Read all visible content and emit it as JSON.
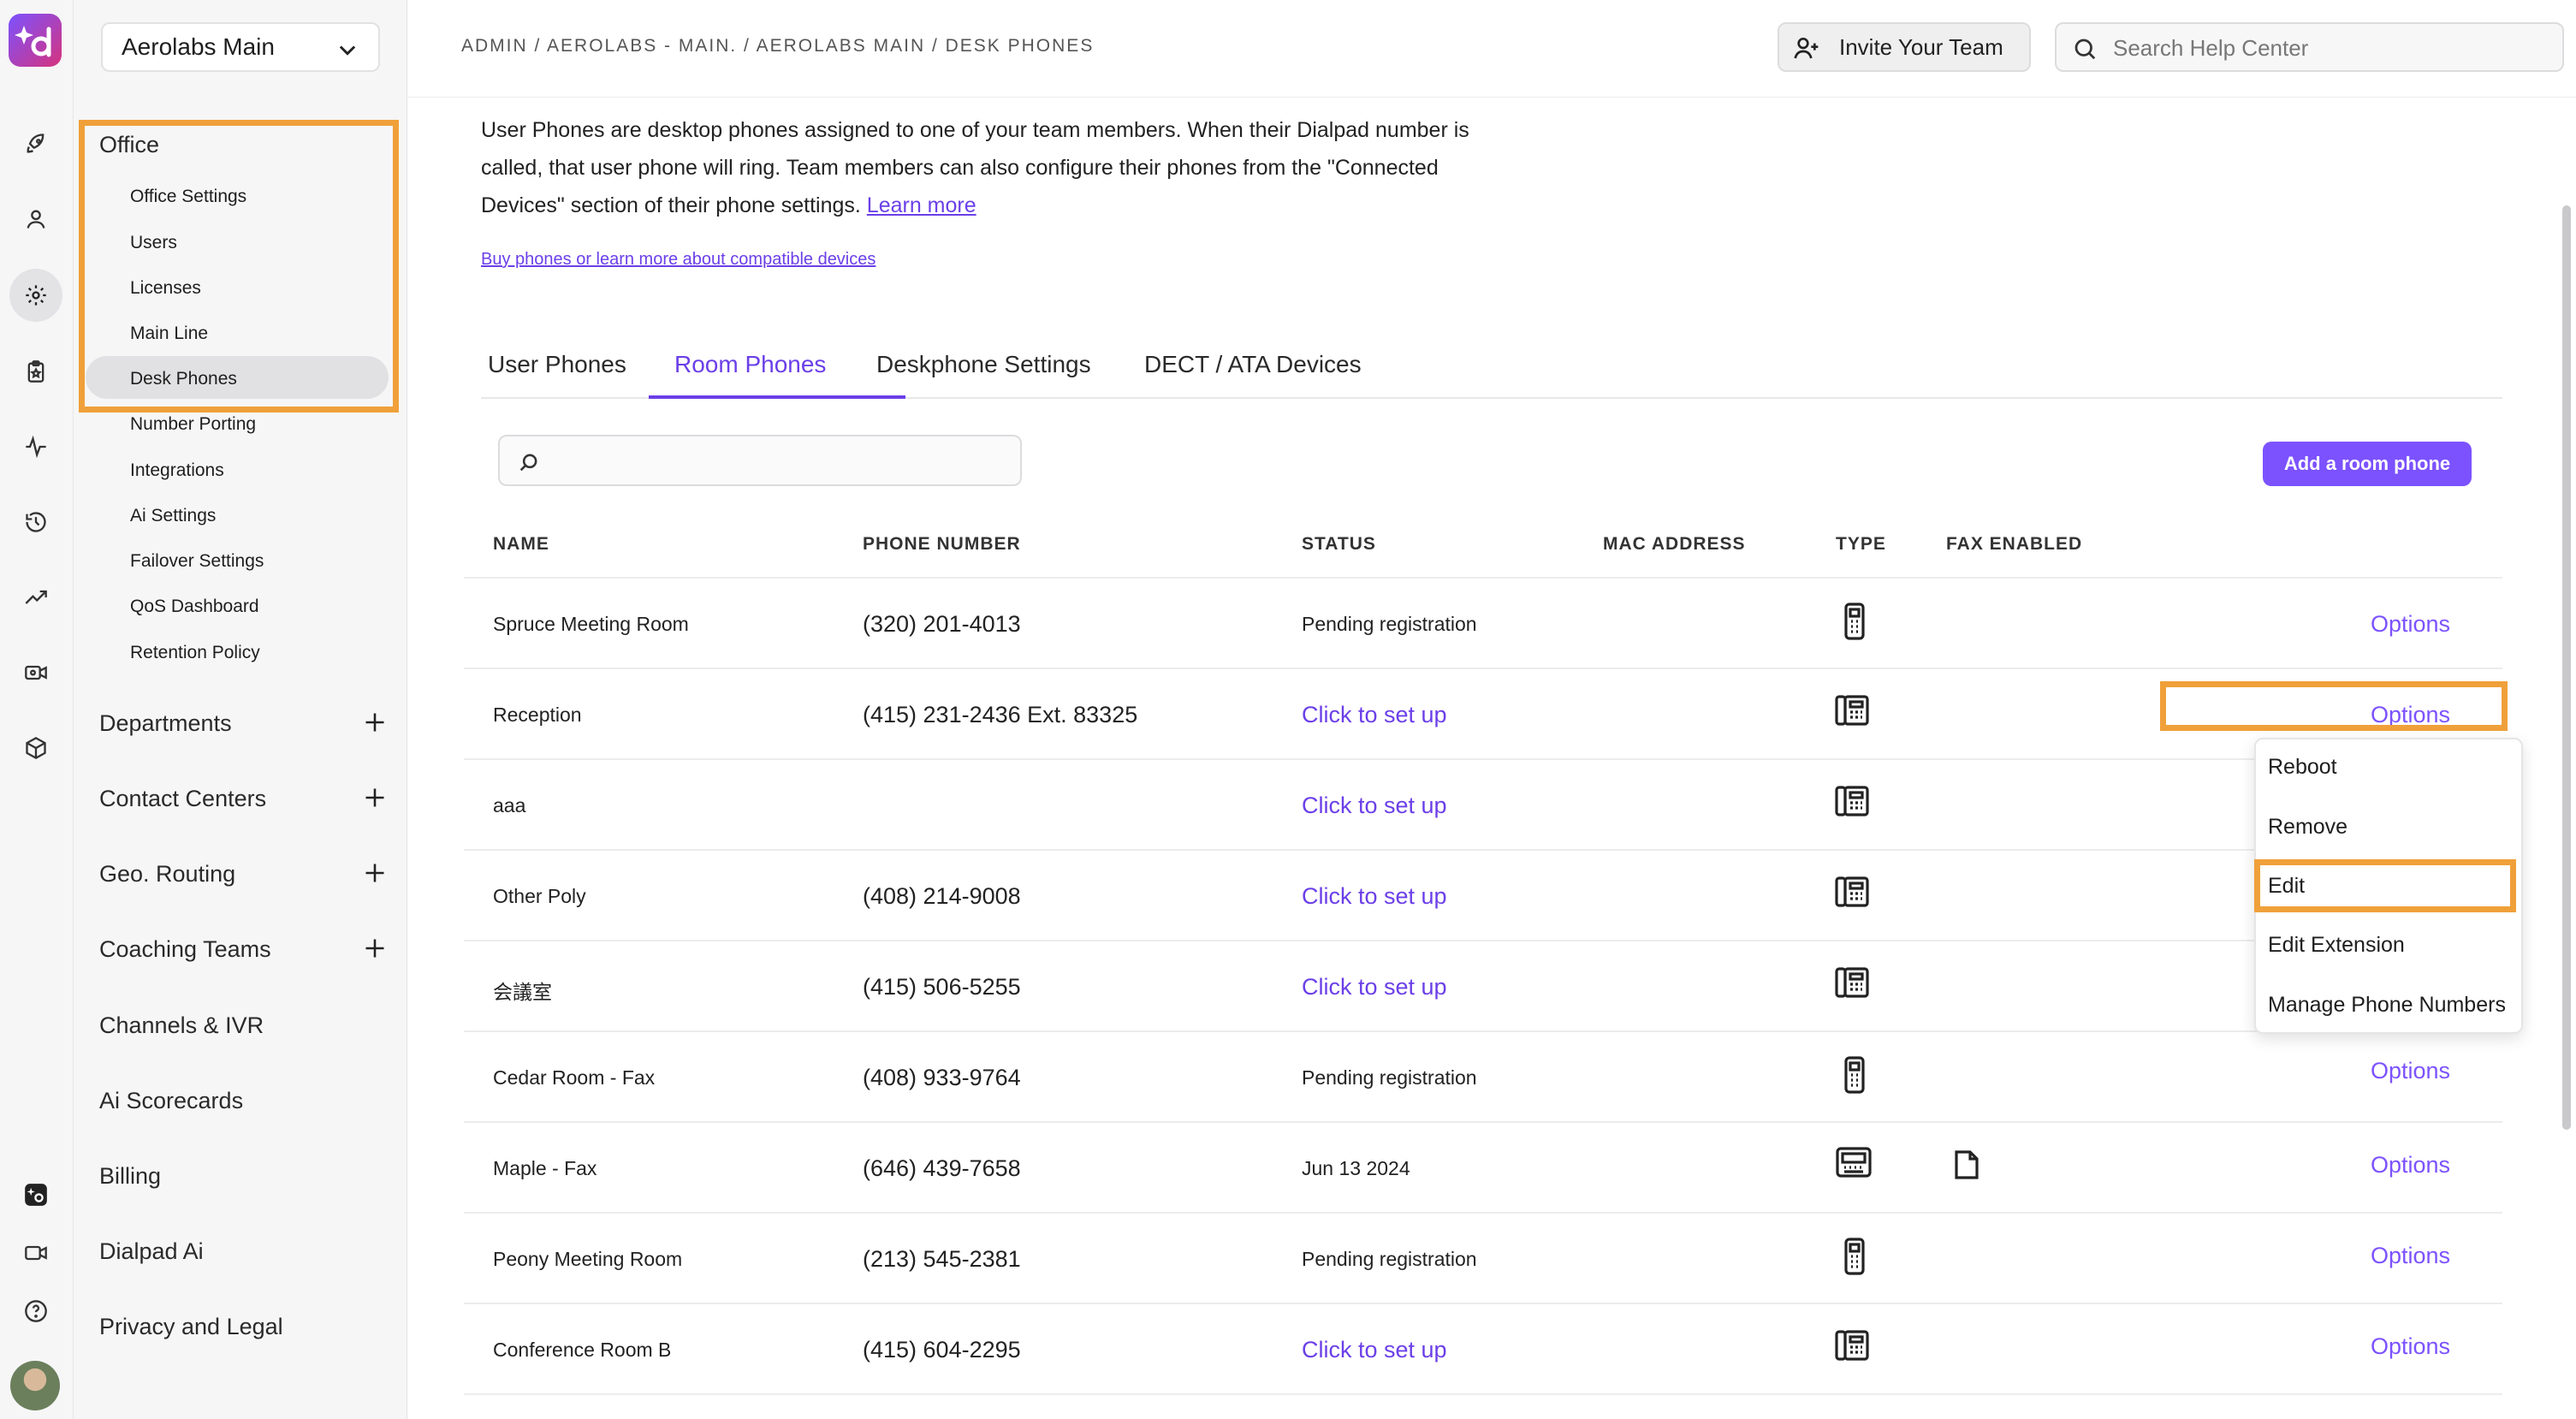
{
  "sidebar": {
    "org_name": "Aerolabs Main",
    "office": {
      "label": "Office",
      "items": [
        {
          "label": "Office Settings"
        },
        {
          "label": "Users"
        },
        {
          "label": "Licenses"
        },
        {
          "label": "Main Line"
        },
        {
          "label": "Desk Phones",
          "active": true
        },
        {
          "label": "Number Porting"
        },
        {
          "label": "Integrations"
        },
        {
          "label": "Ai Settings"
        },
        {
          "label": "Failover Settings"
        },
        {
          "label": "QoS Dashboard"
        },
        {
          "label": "Retention Policy"
        }
      ]
    },
    "sections": [
      {
        "label": "Departments",
        "expandable": true
      },
      {
        "label": "Contact Centers",
        "expandable": true
      },
      {
        "label": "Geo. Routing",
        "expandable": true
      },
      {
        "label": "Coaching Teams",
        "expandable": true
      },
      {
        "label": "Channels & IVR",
        "expandable": false
      },
      {
        "label": "Ai Scorecards",
        "expandable": false
      },
      {
        "label": "Billing",
        "expandable": false
      },
      {
        "label": "Dialpad Ai",
        "expandable": false
      },
      {
        "label": "Privacy and Legal",
        "expandable": false
      }
    ]
  },
  "header": {
    "breadcrumb": "ADMIN / AEROLABS - MAIN. / AEROLABS MAIN / DESK PHONES",
    "invite_label": "Invite Your Team",
    "search_placeholder": "Search Help Center"
  },
  "content": {
    "description": "User Phones are desktop phones assigned to one of your team members. When their Dialpad number is called, that user phone will ring. Team members can also configure their phones from the \"Connected Devices\" section of their phone settings.",
    "learn_more": "Learn more",
    "buy_link": "Buy phones or learn more about compatible devices",
    "tabs": [
      {
        "label": "User Phones",
        "active": false
      },
      {
        "label": "Room Phones",
        "active": true
      },
      {
        "label": "Deskphone Settings",
        "active": false
      },
      {
        "label": "DECT / ATA Devices",
        "active": false
      }
    ],
    "add_button": "Add a room phone",
    "columns": {
      "name": "NAME",
      "phone": "PHONE NUMBER",
      "status": "STATUS",
      "mac": "MAC ADDRESS",
      "type": "TYPE",
      "fax": "FAX ENABLED"
    },
    "rows": [
      {
        "name": "Spruce Meeting Room",
        "phone": "(320) 201-4013",
        "status": "Pending registration",
        "status_link": false,
        "type": "handset-icon",
        "fax": false,
        "options": "Options"
      },
      {
        "name": "Reception",
        "phone": "(415) 231-2436 Ext. 83325",
        "status": "Click to set up",
        "status_link": true,
        "type": "deskphone-icon",
        "fax": false,
        "options": "Options"
      },
      {
        "name": "aaa",
        "phone": "",
        "status": "Click to set up",
        "status_link": true,
        "type": "deskphone-icon",
        "fax": false,
        "options": ""
      },
      {
        "name": "Other Poly",
        "phone": "(408) 214-9008",
        "status": "Click to set up",
        "status_link": true,
        "type": "deskphone-icon",
        "fax": false,
        "options": ""
      },
      {
        "name": "会議室",
        "phone": "(415) 506-5255",
        "status": "Click to set up",
        "status_link": true,
        "type": "deskphone-icon",
        "fax": false,
        "options": ""
      },
      {
        "name": "Cedar Room - Fax",
        "phone": "(408) 933-9764",
        "status": "Pending registration",
        "status_link": false,
        "type": "handset-icon",
        "fax": false,
        "options": "Options"
      },
      {
        "name": "Maple - Fax",
        "phone": "(646) 439-7658",
        "status": "Jun 13 2024",
        "status_link": false,
        "type": "fax-machine-icon",
        "fax": true,
        "options": "Options"
      },
      {
        "name": "Peony Meeting Room",
        "phone": "(213) 545-2381",
        "status": "Pending registration",
        "status_link": false,
        "type": "handset-icon",
        "fax": false,
        "options": "Options"
      },
      {
        "name": "Conference Room B",
        "phone": "(415) 604-2295",
        "status": "Click to set up",
        "status_link": true,
        "type": "deskphone-icon",
        "fax": false,
        "options": "Options"
      }
    ],
    "dropdown": [
      {
        "label": "Reboot"
      },
      {
        "label": "Remove"
      },
      {
        "label": "Edit",
        "highlighted": true
      },
      {
        "label": "Edit Extension"
      },
      {
        "label": "Manage Phone Numbers"
      }
    ]
  },
  "colors": {
    "accent": "#7c52ff",
    "link": "#6b3fe8",
    "highlight": "#f0a03a"
  }
}
